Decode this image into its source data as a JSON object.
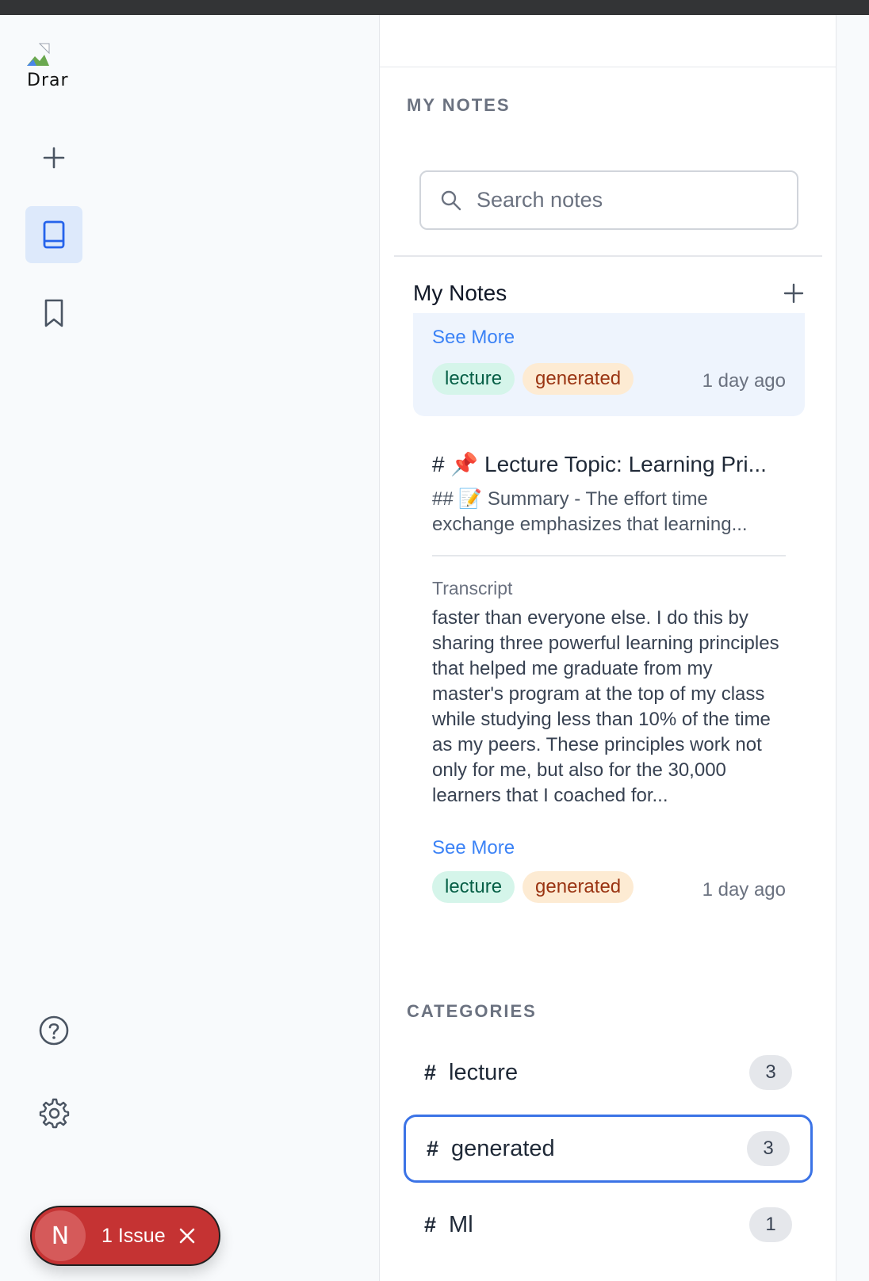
{
  "app": {
    "logo_alt": "Drar"
  },
  "rail": {
    "items": [
      {
        "name": "new-note",
        "icon": "plus-icon"
      },
      {
        "name": "notes",
        "icon": "book-icon",
        "active": true
      },
      {
        "name": "bookmarks",
        "icon": "bookmark-icon"
      },
      {
        "name": "help",
        "icon": "help-circle-icon"
      },
      {
        "name": "settings",
        "icon": "gear-icon"
      }
    ]
  },
  "issue_badge": {
    "letter": "N",
    "label": "1 Issue"
  },
  "notes_panel": {
    "section_title": "MY NOTES",
    "search": {
      "placeholder": "Search notes",
      "value": ""
    },
    "list_title": "My Notes",
    "notes": [
      {
        "see_more": "See More",
        "tags": [
          "lecture",
          "generated"
        ],
        "time": "1 day ago",
        "selected": true
      },
      {
        "title": "# 📌 Lecture Topic: Learning Pri...",
        "summary": "## 📝 Summary - The effort time exchange emphasizes that learning...",
        "transcript_label": "Transcript",
        "transcript": "faster than everyone else. I do this by sharing three powerful learning principles that helped me graduate from my master's program at the top of my class while studying less than 10% of the time as my peers. These principles work not only for me, but also for the 30,000 learners that I coached for...",
        "see_more": "See More",
        "tags": [
          "lecture",
          "generated"
        ],
        "time": "1 day ago"
      }
    ]
  },
  "categories": {
    "title": "CATEGORIES",
    "items": [
      {
        "hash": "#",
        "name": "lecture",
        "count": "3"
      },
      {
        "hash": "#",
        "name": "generated",
        "count": "3",
        "focused": true
      },
      {
        "hash": "#",
        "name": "Ml",
        "count": "1"
      }
    ]
  },
  "colors": {
    "accent": "#3b82f6",
    "active_rail": "#dde9fb",
    "tag_lecture_bg": "#d5f5ea",
    "tag_generated_bg": "#fdebd3",
    "issue_badge": "#c53333"
  }
}
